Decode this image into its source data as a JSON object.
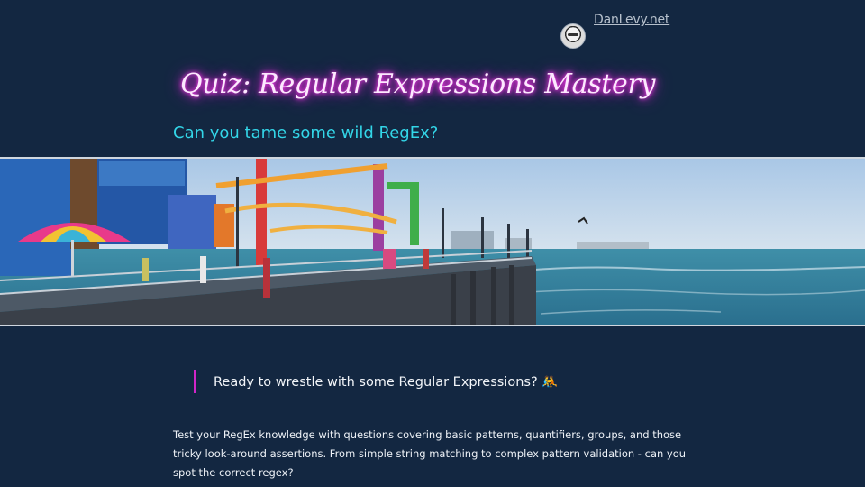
{
  "header": {
    "site_link": "DanLevy.net",
    "avatar_icon": "avatar-icon"
  },
  "hero": {
    "title": "Quiz: Regular Expressions Mastery",
    "subtitle": "Can you tame some wild RegEx?",
    "title_glow_color": "#ff2ee6",
    "subtitle_color": "#33d6e8"
  },
  "callout": {
    "text": "Ready to wrestle with some Regular Expressions? 🤼",
    "accent_color": "#d226c9"
  },
  "intro": {
    "text": "Test your RegEx knowledge with questions covering basic patterns, quantifiers, groups, and those tricky look-around assertions. From simple string matching to complex pattern validation - can you spot the correct regex?"
  }
}
